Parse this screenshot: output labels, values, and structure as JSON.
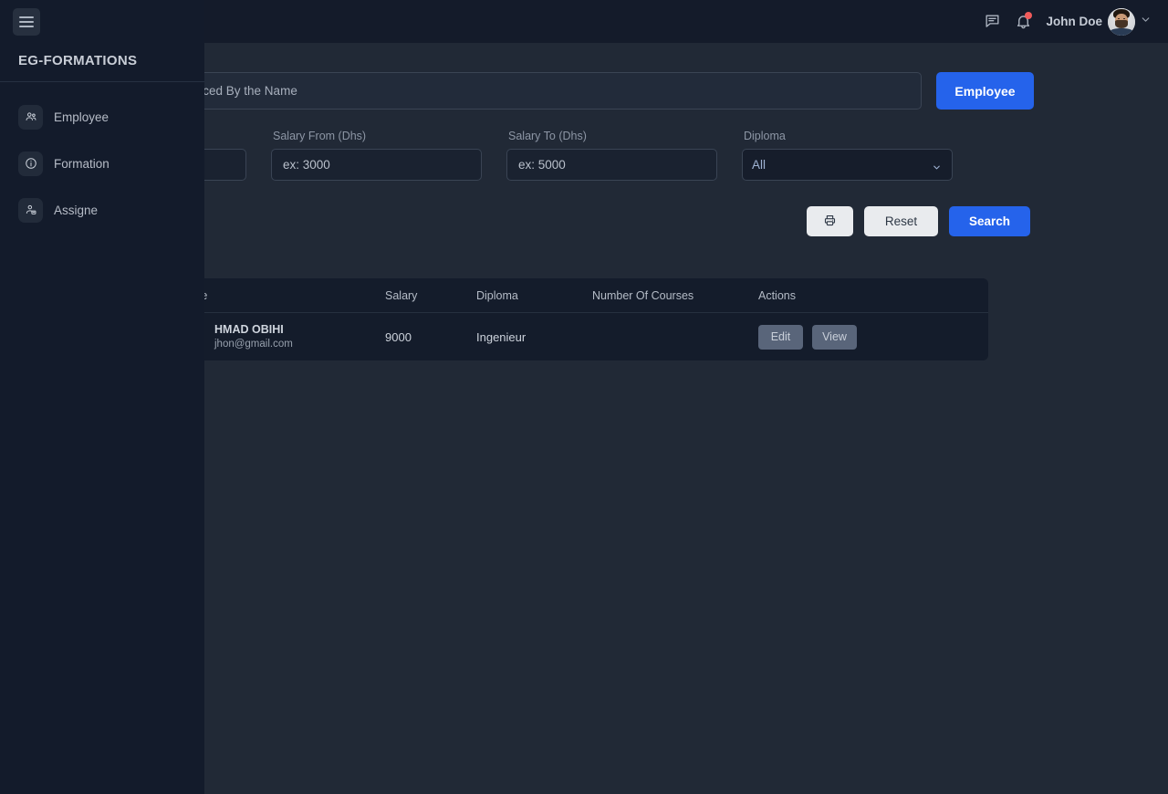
{
  "navbar": {
    "messages_icon": "chat-icon",
    "notifications_icon": "bell-icon",
    "username": "John Doe",
    "avatar_icon": "user-avatar",
    "chevron_icon": "chevron-down-icon"
  },
  "sidebar": {
    "menu_toggle_icon": "hamburger-icon",
    "brand": "EG-FORMATIONS",
    "items": [
      {
        "label": "Employee",
        "icon": "users-group-icon"
      },
      {
        "label": "Formation",
        "icon": "info-circle-icon"
      },
      {
        "label": "Assigne",
        "icon": "user-settings-icon"
      }
    ]
  },
  "search": {
    "placeholder": "Replaced By the Name",
    "value": "",
    "employee_button": "Employee"
  },
  "filters": {
    "hidden_field": {
      "label": "",
      "placeholder": "",
      "value": ""
    },
    "salary_from": {
      "label": "Salary From (Dhs)",
      "placeholder": "ex: 3000",
      "value": ""
    },
    "salary_to": {
      "label": "Salary To (Dhs)",
      "placeholder": "ex: 5000",
      "value": ""
    },
    "diploma": {
      "label": "Diploma",
      "selected": "All",
      "options": [
        "All"
      ]
    }
  },
  "actions": {
    "print_label": "",
    "print_icon": "printer-icon",
    "reset_label": "Reset",
    "search_label": "Search"
  },
  "table": {
    "columns": [
      "Name",
      "Salary",
      "Diploma",
      "Number Of Courses",
      "Actions"
    ],
    "rows": [
      {
        "name": "HMAD OBIHI",
        "email": "jhon@gmail.com",
        "salary": "9000",
        "diploma": "Ingenieur",
        "courses": "",
        "edit_label": "Edit",
        "view_label": "View"
      }
    ]
  },
  "colors": {
    "accent": "#2563eb",
    "page_bg": "#212936",
    "navbar_bg": "#141b2a",
    "sidebar_bg": "#131b2b",
    "table_bg": "#141c2b",
    "badge": "#f05b5b",
    "light_button": "#e9ebee",
    "action_button": "#59657a"
  }
}
